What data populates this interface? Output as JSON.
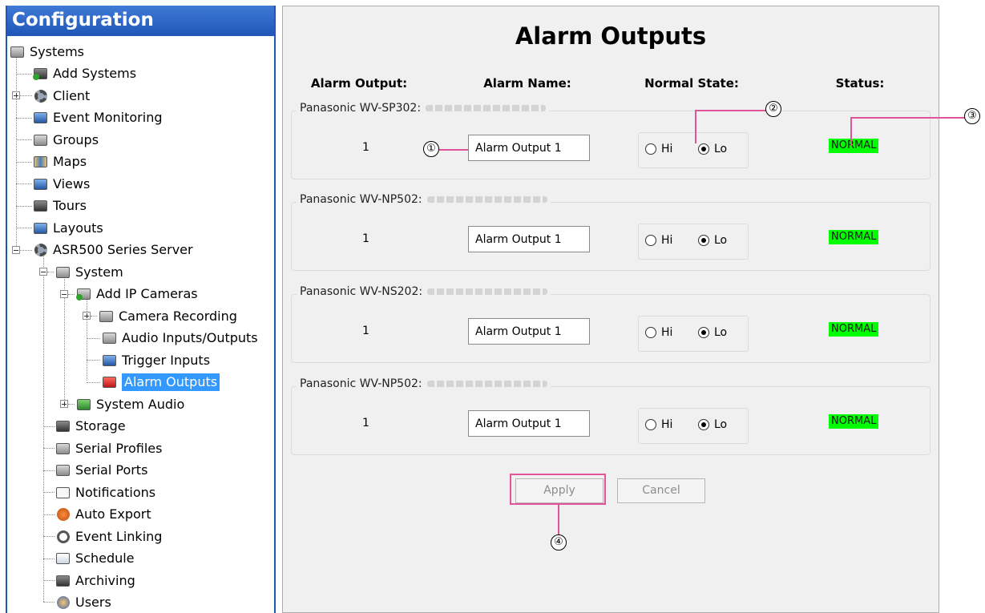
{
  "tree": {
    "header": "Configuration",
    "items": [
      {
        "label": "Systems"
      },
      {
        "label": "Add Systems"
      },
      {
        "label": "Client"
      },
      {
        "label": "Event Monitoring"
      },
      {
        "label": "Groups"
      },
      {
        "label": "Maps"
      },
      {
        "label": "Views"
      },
      {
        "label": "Tours"
      },
      {
        "label": "Layouts"
      },
      {
        "label": "ASR500 Series Server"
      },
      {
        "label": "System"
      },
      {
        "label": "Add IP Cameras"
      },
      {
        "label": "Camera Recording"
      },
      {
        "label": "Audio Inputs/Outputs"
      },
      {
        "label": "Trigger Inputs"
      },
      {
        "label": "Alarm Outputs"
      },
      {
        "label": "System Audio"
      },
      {
        "label": "Storage"
      },
      {
        "label": "Serial Profiles"
      },
      {
        "label": "Serial Ports"
      },
      {
        "label": "Notifications"
      },
      {
        "label": "Auto Export"
      },
      {
        "label": "Event Linking"
      },
      {
        "label": "Schedule"
      },
      {
        "label": "Archiving"
      },
      {
        "label": "Users"
      }
    ],
    "selected": "Alarm Outputs"
  },
  "main": {
    "title": "Alarm Outputs",
    "columns": {
      "output": "Alarm Output:",
      "name": "Alarm Name:",
      "normal_state": "Normal State:",
      "status": "Status:"
    },
    "groups": [
      {
        "device": "Panasonic WV-SP302:",
        "output_number": "1",
        "alarm_name": "Alarm Output 1",
        "hi_label": "Hi",
        "lo_label": "Lo",
        "selected_state": "Lo",
        "status": "NORMAL"
      },
      {
        "device": "Panasonic WV-NP502:",
        "output_number": "1",
        "alarm_name": "Alarm Output 1",
        "hi_label": "Hi",
        "lo_label": "Lo",
        "selected_state": "Lo",
        "status": "NORMAL"
      },
      {
        "device": "Panasonic WV-NS202:",
        "output_number": "1",
        "alarm_name": "Alarm Output 1",
        "hi_label": "Hi",
        "lo_label": "Lo",
        "selected_state": "Lo",
        "status": "NORMAL"
      },
      {
        "device": "Panasonic WV-NP502:",
        "output_number": "1",
        "alarm_name": "Alarm Output 1",
        "hi_label": "Hi",
        "lo_label": "Lo",
        "selected_state": "Lo",
        "status": "NORMAL"
      }
    ],
    "buttons": {
      "apply": "Apply",
      "cancel": "Cancel"
    },
    "status_color": "#00ff00"
  },
  "callouts": [
    "①",
    "②",
    "③",
    "④"
  ],
  "colors": {
    "header_blue": "#1f56b8",
    "selection": "#3399ff",
    "callout": "#e0559a"
  }
}
